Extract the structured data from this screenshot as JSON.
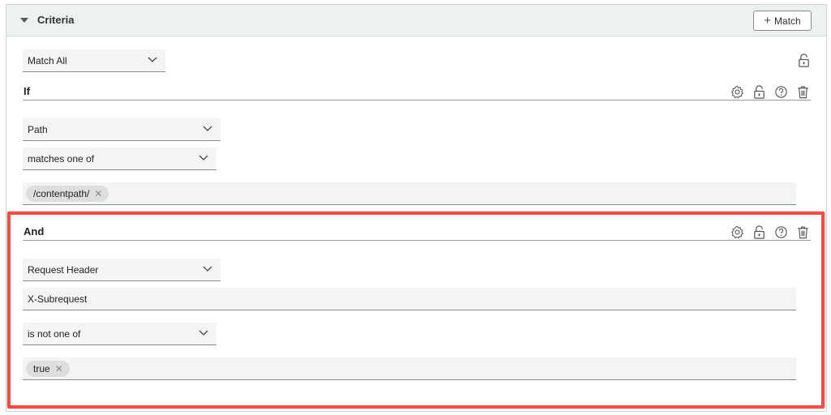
{
  "criteria": {
    "title": "Criteria",
    "match_button_label": "Match",
    "match_mode": "Match All"
  },
  "if_block": {
    "title": "If",
    "field": "Path",
    "operator": "matches one of",
    "values": [
      "/contentpath/"
    ]
  },
  "and_block": {
    "title": "And",
    "field": "Request Header",
    "header_name": "X-Subrequest",
    "operator": "is not one of",
    "values": [
      "true"
    ]
  },
  "icons": {
    "header_caret": "caret-down-icon",
    "settings": "gear-icon",
    "lock": "lock-icon",
    "help": "help-icon",
    "delete": "trash-icon",
    "chip_remove": "close-icon",
    "dropdown": "chevron-down-icon"
  },
  "colors": {
    "highlight": "#e8504a",
    "header_bg": "#eef1f1",
    "field_bg": "#f4f4f4"
  }
}
